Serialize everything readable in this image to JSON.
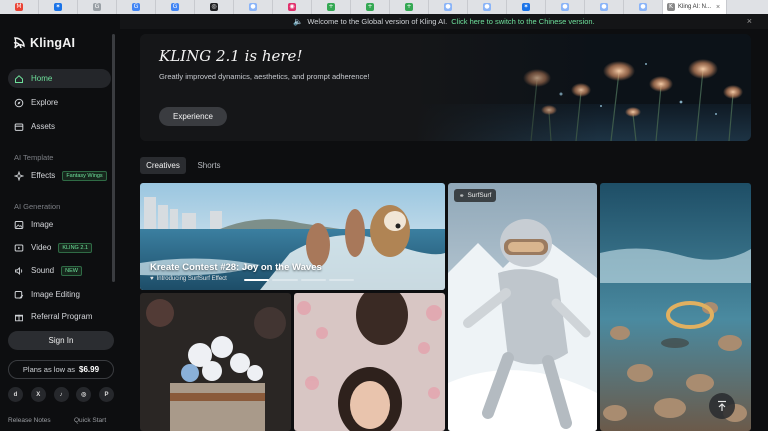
{
  "browser": {
    "tabs": [
      {
        "icon": "gmail-icon",
        "glyph": "M",
        "color": "#ea4335"
      },
      {
        "icon": "app-icon",
        "glyph": "✶",
        "color": "#1a73e8"
      },
      {
        "icon": "google-icon",
        "glyph": "G",
        "color": "#9aa0a6"
      },
      {
        "icon": "google-icon",
        "glyph": "G",
        "color": "#4285f4"
      },
      {
        "icon": "google-icon",
        "glyph": "G",
        "color": "#4285f4"
      },
      {
        "icon": "openai-icon",
        "glyph": "◎",
        "color": "#202124"
      },
      {
        "icon": "globe-icon",
        "glyph": "●",
        "color": "#8ab4f8"
      },
      {
        "icon": "instagram-icon",
        "glyph": "◉",
        "color": "#e1306c"
      },
      {
        "icon": "sheets-icon",
        "glyph": "+",
        "color": "#34a853"
      },
      {
        "icon": "sheets-icon",
        "glyph": "+",
        "color": "#34a853"
      },
      {
        "icon": "sheets-icon",
        "glyph": "+",
        "color": "#34a853"
      },
      {
        "icon": "globe-icon",
        "glyph": "●",
        "color": "#8ab4f8"
      },
      {
        "icon": "globe-icon",
        "glyph": "●",
        "color": "#8ab4f8"
      },
      {
        "icon": "app-icon",
        "glyph": "✶",
        "color": "#1a73e8"
      },
      {
        "icon": "globe-icon",
        "glyph": "●",
        "color": "#8ab4f8"
      },
      {
        "icon": "globe-icon",
        "glyph": "●",
        "color": "#8ab4f8"
      },
      {
        "icon": "globe-icon",
        "glyph": "●",
        "color": "#8ab4f8"
      }
    ],
    "active_tab": {
      "glyph": "K",
      "label": "Kling AI: N...",
      "close": "×"
    }
  },
  "announcement": {
    "text": "Welcome to the Global version of Kling AI.",
    "link": "Click here to switch to the Chinese version.",
    "close": "×"
  },
  "sidebar": {
    "brand": "KlingAI",
    "nav": [
      {
        "label": "Home",
        "icon": "home-icon"
      },
      {
        "label": "Explore",
        "icon": "compass-icon"
      },
      {
        "label": "Assets",
        "icon": "folder-icon"
      }
    ],
    "template_section": "AI Template",
    "effects": {
      "label": "Effects",
      "badge": "Fantasy Wings"
    },
    "generation_section": "AI Generation",
    "generation": [
      {
        "label": "Image",
        "icon": "image-icon",
        "badge": ""
      },
      {
        "label": "Video",
        "icon": "video-icon",
        "badge": "KLING 2.1"
      },
      {
        "label": "Sound",
        "icon": "sound-icon",
        "badge": "NEW"
      },
      {
        "label": "Image Editing",
        "icon": "edit-image-icon",
        "badge": ""
      },
      {
        "label": "Referral Program",
        "icon": "gift-icon",
        "badge": ""
      }
    ],
    "sign_in": "Sign In",
    "plans": {
      "text": "Plans as low as",
      "price": "$6.99"
    },
    "socials": [
      {
        "icon": "discord-icon",
        "glyph": "d"
      },
      {
        "icon": "x-icon",
        "glyph": "X"
      },
      {
        "icon": "tiktok-icon",
        "glyph": "♪"
      },
      {
        "icon": "instagram-icon",
        "glyph": "◎"
      },
      {
        "icon": "pinterest-icon",
        "glyph": "P"
      }
    ],
    "release_notes": "Release Notes",
    "quick_start": "Quick Start"
  },
  "hero": {
    "title": "KLING 2.1 is here!",
    "subtitle": "Greatly improved dynamics, aesthetics, and prompt adherence!",
    "button": "Experience"
  },
  "content_tabs": [
    "Creatives",
    "Shorts"
  ],
  "gallery": {
    "contest_title": "Kreate Contest #28: Joy on the Waves",
    "contest_sub": "Introducing SurfSurf Effect",
    "contest_progress_active": 1,
    "tag": "SurfSurf"
  }
}
